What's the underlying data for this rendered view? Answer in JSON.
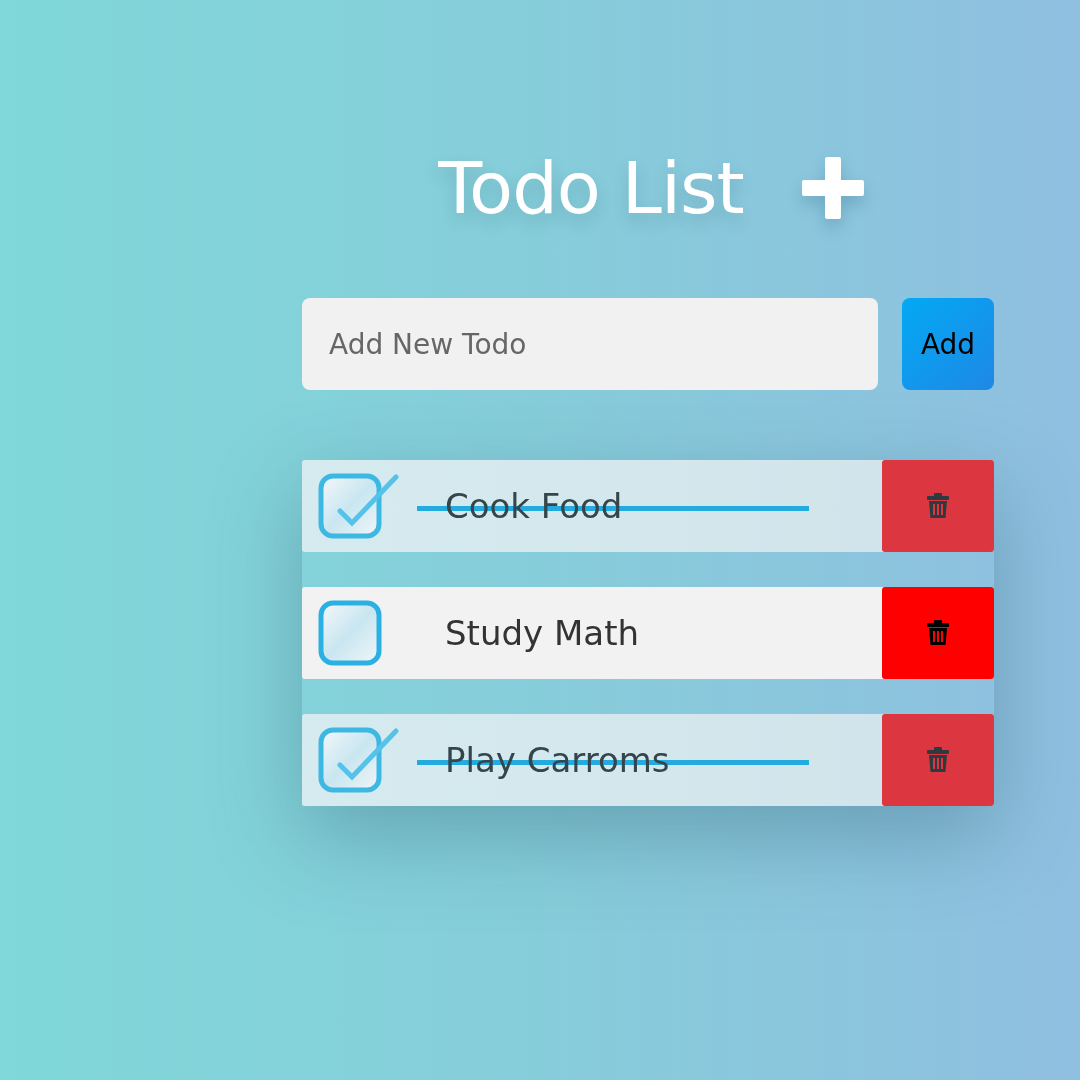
{
  "title": "Todo List",
  "new_todo": {
    "placeholder": "Add New Todo",
    "button": "Add"
  },
  "items": [
    {
      "text": "Cook Food",
      "done": true
    },
    {
      "text": "Study Math",
      "done": false
    },
    {
      "text": "Play Carroms",
      "done": true
    }
  ]
}
